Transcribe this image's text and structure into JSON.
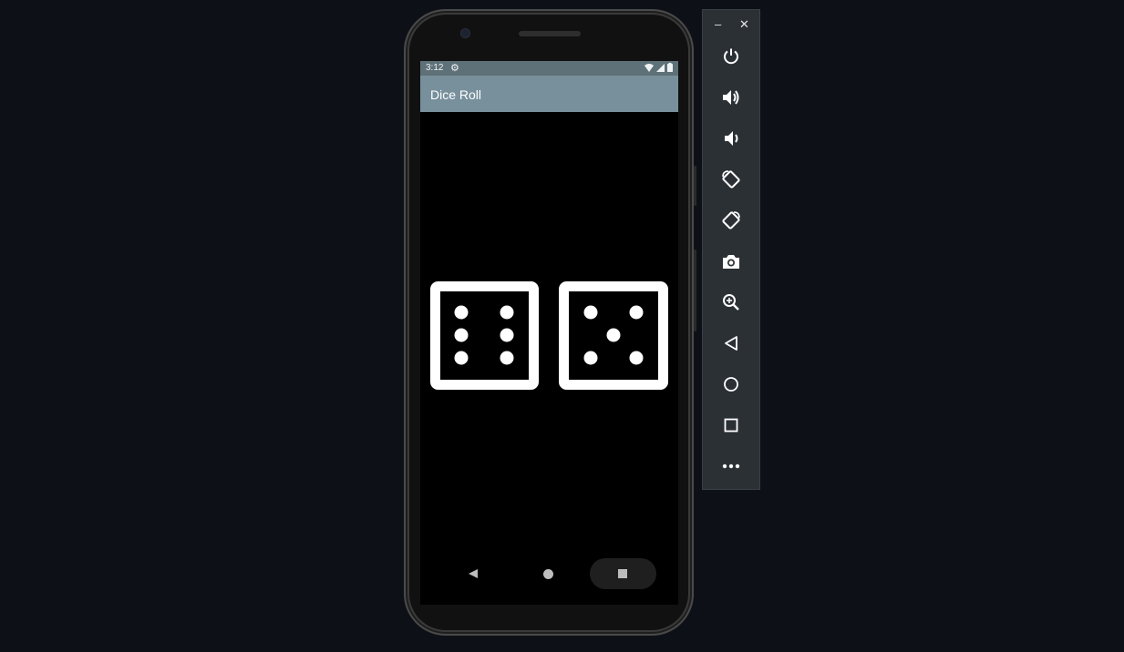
{
  "emulator": {
    "toolbar": {
      "minimize_label": "–",
      "close_label": "✕",
      "buttons": [
        {
          "name": "power-icon"
        },
        {
          "name": "volume-up-icon"
        },
        {
          "name": "volume-down-icon"
        },
        {
          "name": "rotate-left-icon"
        },
        {
          "name": "rotate-right-icon"
        },
        {
          "name": "camera-icon"
        },
        {
          "name": "zoom-icon"
        },
        {
          "name": "back-icon"
        },
        {
          "name": "home-icon"
        },
        {
          "name": "overview-icon"
        },
        {
          "name": "more-icon"
        }
      ]
    }
  },
  "device": {
    "status_bar": {
      "time": "3:12",
      "icons": [
        "settings-icon",
        "wifi-icon",
        "signal-icon",
        "battery-icon"
      ]
    },
    "app_bar": {
      "title": "Dice Roll"
    },
    "dice": [
      {
        "value": 6
      },
      {
        "value": 5
      }
    ],
    "nav_bar": {
      "buttons": [
        "back-nav-icon",
        "home-nav-icon",
        "recents-nav-icon"
      ]
    }
  },
  "colors": {
    "desktop_bg": "#0d1117",
    "status_bar_bg": "#5f7178",
    "app_bar_bg": "#78909c",
    "screen_bg": "#000000",
    "dice_color": "#ffffff",
    "toolbar_bg": "#2b3035"
  }
}
